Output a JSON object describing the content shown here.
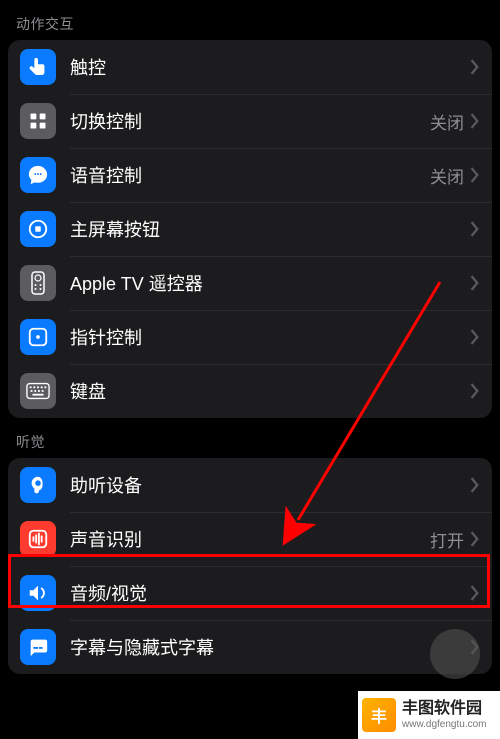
{
  "sections": [
    {
      "header": "动作交互",
      "items": [
        {
          "icon": "touch-icon",
          "bg": "bg-blue",
          "label": "触控",
          "value": ""
        },
        {
          "icon": "switch-control-icon",
          "bg": "bg-gray",
          "label": "切换控制",
          "value": "关闭"
        },
        {
          "icon": "voice-control-icon",
          "bg": "bg-blue",
          "label": "语音控制",
          "value": "关闭"
        },
        {
          "icon": "home-button-icon",
          "bg": "bg-blue",
          "label": "主屏幕按钮",
          "value": ""
        },
        {
          "icon": "apple-tv-remote-icon",
          "bg": "bg-gray",
          "label": "Apple TV 遥控器",
          "value": ""
        },
        {
          "icon": "pointer-control-icon",
          "bg": "bg-blue",
          "label": "指针控制",
          "value": ""
        },
        {
          "icon": "keyboard-icon",
          "bg": "bg-gray",
          "label": "键盘",
          "value": ""
        }
      ]
    },
    {
      "header": "听觉",
      "items": [
        {
          "icon": "hearing-devices-icon",
          "bg": "bg-blue",
          "label": "助听设备",
          "value": ""
        },
        {
          "icon": "sound-recognition-icon",
          "bg": "bg-red",
          "label": "声音识别",
          "value": "打开"
        },
        {
          "icon": "audio-visual-icon",
          "bg": "bg-blue",
          "label": "音频/视觉",
          "value": ""
        },
        {
          "icon": "subtitles-icon",
          "bg": "bg-blue",
          "label": "字幕与隐藏式字幕",
          "value": ""
        }
      ]
    }
  ],
  "watermark": {
    "title": "丰图软件园",
    "url": "www.dgfengtu.com"
  }
}
